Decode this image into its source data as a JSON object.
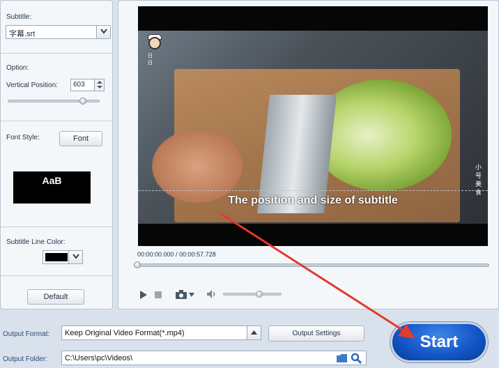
{
  "left_panel": {
    "subtitle_label": "Subtitle:",
    "subtitle_value": "字幕.srt",
    "option_label": "Option:",
    "vertical_position_label": "Vertical Position:",
    "vertical_position_value": "603",
    "vertical_position_slider_fraction": 0.82,
    "font_style_label": "Font Style:",
    "font_button_label": "Font",
    "font_preview_text": "AaB",
    "subtitle_line_color_label": "Subtitle Line Color:",
    "subtitle_line_color": "#000000",
    "default_button_label": "Default"
  },
  "video": {
    "subtitle_overlay_text": "The position and size of subtitle",
    "logo_text": "日 日",
    "vertical_watermark": "小 号 美 食",
    "time_display": "00:00:00.000 / 00:00:57.728",
    "playback_progress_fraction": 0.0,
    "volume_fraction": 0.62
  },
  "bottom": {
    "output_format_label": "Output Format:",
    "output_format_value": "Keep Original Video Format(*.mp4)",
    "output_settings_label": "Output Settings",
    "output_folder_label": "Output Folder:",
    "output_folder_value": "C:\\Users\\pc\\Videos\\",
    "start_label": "Start"
  },
  "colors": {
    "accent": "#1457c9",
    "annotation_arrow": "#e23a2c"
  },
  "icons": [
    "chevron-down-icon",
    "play-icon",
    "stop-icon",
    "camera-icon",
    "volume-icon",
    "folder-icon",
    "search-icon"
  ]
}
